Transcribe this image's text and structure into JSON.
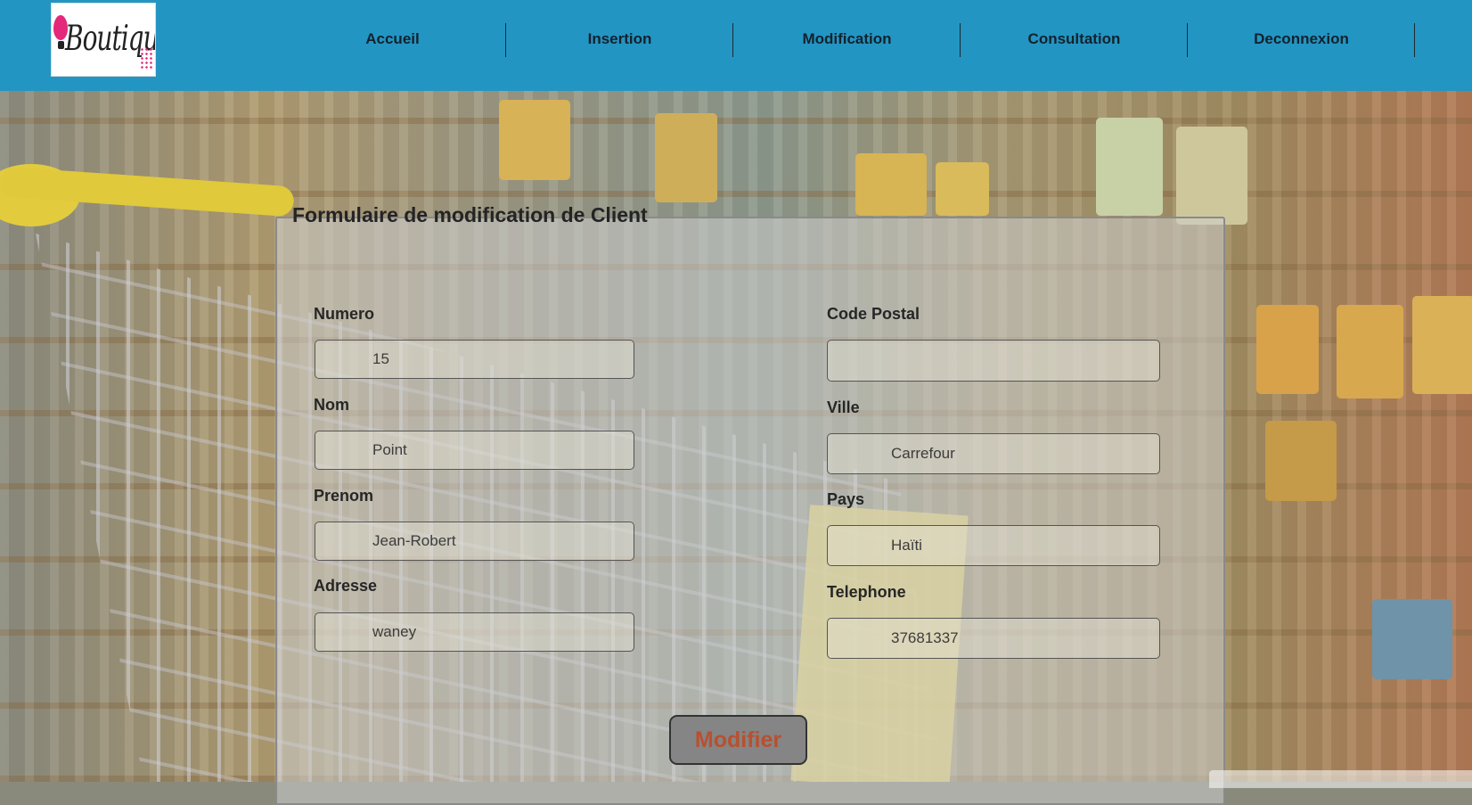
{
  "header": {
    "logo_text": "Boutique",
    "nav": [
      {
        "label": "Accueil"
      },
      {
        "label": "Insertion"
      },
      {
        "label": "Modification"
      },
      {
        "label": "Consultation"
      },
      {
        "label": "Deconnexion"
      }
    ]
  },
  "form": {
    "legend": "Formulaire de modification de Client",
    "left_fields": [
      {
        "label": "Numero",
        "value": "15"
      },
      {
        "label": "Nom",
        "value": "Point"
      },
      {
        "label": "Prenom",
        "value": "Jean-Robert"
      },
      {
        "label": "Adresse",
        "value": "waney"
      }
    ],
    "right_fields": [
      {
        "label": "Code Postal",
        "value": ""
      },
      {
        "label": "Ville",
        "value": "Carrefour"
      },
      {
        "label": "Pays",
        "value": "Haïti"
      },
      {
        "label": "Telephone",
        "value": "37681337"
      }
    ],
    "submit_label": "Modifier"
  },
  "colors": {
    "header_bg": "#2395c2",
    "submit_text": "#b8502f"
  }
}
